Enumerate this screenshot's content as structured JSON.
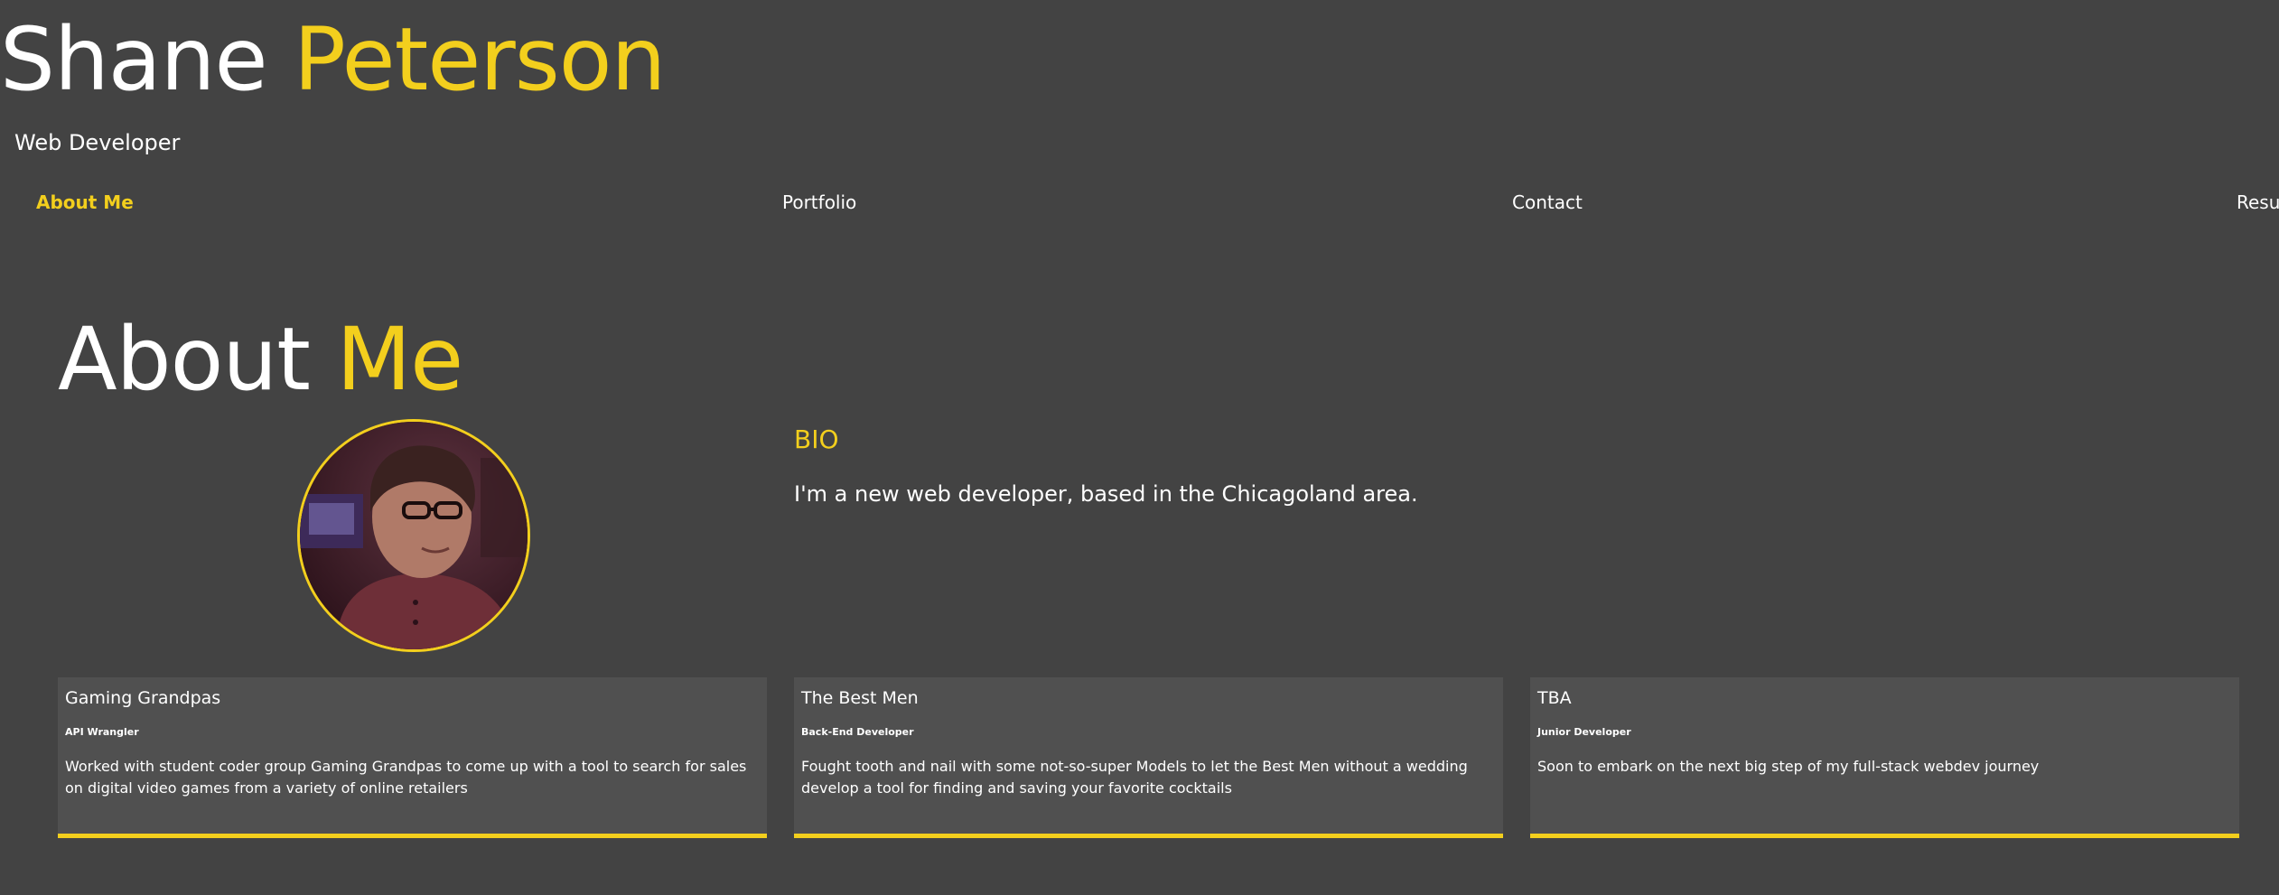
{
  "header": {
    "name_first": "Shane",
    "name_last": "Peterson",
    "subtitle": "Web Developer"
  },
  "nav": {
    "items": [
      {
        "label": "About Me",
        "active": true
      },
      {
        "label": "Portfolio",
        "active": false
      },
      {
        "label": "Contact",
        "active": false
      },
      {
        "label": "Resume",
        "active": false
      }
    ]
  },
  "about": {
    "title_part1": "About",
    "title_part2": "Me",
    "bio_heading": "BIO",
    "bio_text": "I'm a new web developer, based in the Chicagoland area."
  },
  "cards": [
    {
      "title": "Gaming Grandpas",
      "role": "API Wrangler",
      "description": "Worked with student coder group Gaming Grandpas to come up with a tool to search for sales on digital video games from a variety of online retailers"
    },
    {
      "title": "The Best Men",
      "role": "Back-End Developer",
      "description": "Fought tooth and nail with some not-so-super Models to let the Best Men without a wedding develop a tool for finding and saving your favorite cocktails"
    },
    {
      "title": "TBA",
      "role": "Junior Developer",
      "description": "Soon to embark on the next big step of my full-stack webdev journey"
    }
  ],
  "colors": {
    "background": "#434343",
    "accent": "#f3cf1d",
    "card": "#505050"
  }
}
